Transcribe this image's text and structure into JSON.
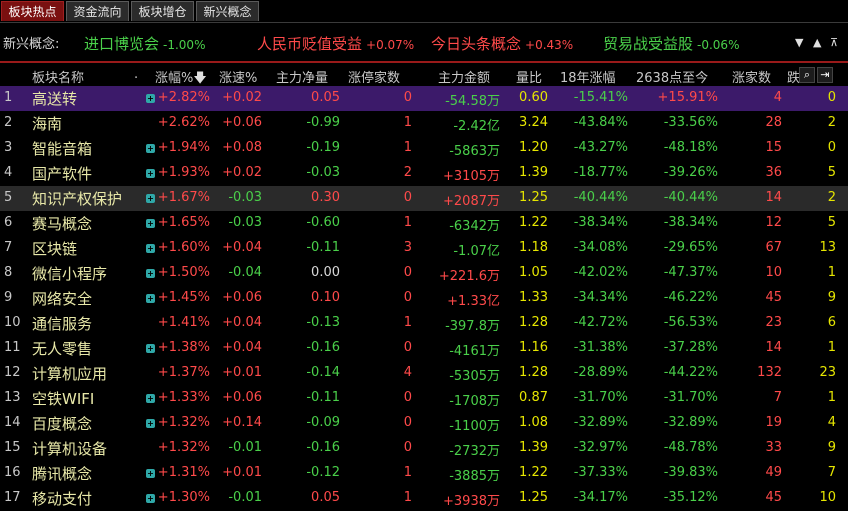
{
  "tabs": [
    {
      "label": "板块热点",
      "active": true
    },
    {
      "label": "资金流向",
      "active": false
    },
    {
      "label": "板块增仓",
      "active": false
    },
    {
      "label": "新兴概念",
      "active": false
    }
  ],
  "ticker": {
    "label": "新兴概念:",
    "items": [
      {
        "name": "进口博览会",
        "value": "-1.00%",
        "color": "#4ad04a"
      },
      {
        "name": "人民币贬值受益",
        "value": "+0.07%",
        "color": "#ff4a4a"
      },
      {
        "name": "今日头条概念",
        "value": "+0.43%",
        "color": "#ff4a4a"
      },
      {
        "name": "贸易战受益股",
        "value": "-0.06%",
        "color": "#4ad04a"
      }
    ]
  },
  "header": {
    "name": "板块名称",
    "dot": ".",
    "change": "涨幅%",
    "speed": "涨速%",
    "main_net": "主力净量",
    "limit_up": "涨停家数",
    "main_amount": "主力金额",
    "vol_ratio": "量比",
    "year18": "18年涨幅",
    "since2638": "2638点至今",
    "rising": "涨家数",
    "fall": "跌"
  },
  "rows": [
    {
      "idx": "1",
      "name": "高送转",
      "plus": true,
      "change": "+2.82%",
      "speed": "+0.02",
      "net": "0.05",
      "limit": "0",
      "amount": "-54.58万",
      "ratio": "0.60",
      "y18": "-15.41%",
      "since": "+15.91%",
      "up": "4",
      "down": "0",
      "highlight": "sel"
    },
    {
      "idx": "2",
      "name": "海南",
      "plus": false,
      "change": "+2.62%",
      "speed": "+0.06",
      "net": "-0.99",
      "limit": "1",
      "amount": "-2.42亿",
      "ratio": "3.24",
      "y18": "-43.84%",
      "since": "-33.56%",
      "up": "28",
      "down": "2",
      "highlight": ""
    },
    {
      "idx": "3",
      "name": "智能音箱",
      "plus": true,
      "change": "+1.94%",
      "speed": "+0.08",
      "net": "-0.19",
      "limit": "1",
      "amount": "-5863万",
      "ratio": "1.20",
      "y18": "-43.27%",
      "since": "-48.18%",
      "up": "15",
      "down": "0",
      "highlight": ""
    },
    {
      "idx": "4",
      "name": "国产软件",
      "plus": true,
      "change": "+1.93%",
      "speed": "+0.02",
      "net": "-0.03",
      "limit": "2",
      "amount": "+3105万",
      "ratio": "1.39",
      "y18": "-18.77%",
      "since": "-39.26%",
      "up": "36",
      "down": "5",
      "highlight": ""
    },
    {
      "idx": "5",
      "name": "知识产权保护",
      "plus": true,
      "change": "+1.67%",
      "speed": "-0.03",
      "net": "0.30",
      "limit": "0",
      "amount": "+2087万",
      "ratio": "1.25",
      "y18": "-40.44%",
      "since": "-40.44%",
      "up": "14",
      "down": "2",
      "highlight": "alt"
    },
    {
      "idx": "6",
      "name": "赛马概念",
      "plus": true,
      "change": "+1.65%",
      "speed": "-0.03",
      "net": "-0.60",
      "limit": "1",
      "amount": "-6342万",
      "ratio": "1.22",
      "y18": "-38.34%",
      "since": "-38.34%",
      "up": "12",
      "down": "5",
      "highlight": ""
    },
    {
      "idx": "7",
      "name": "区块链",
      "plus": true,
      "change": "+1.60%",
      "speed": "+0.04",
      "net": "-0.11",
      "limit": "3",
      "amount": "-1.07亿",
      "ratio": "1.18",
      "y18": "-34.08%",
      "since": "-29.65%",
      "up": "67",
      "down": "13",
      "highlight": ""
    },
    {
      "idx": "8",
      "name": "微信小程序",
      "plus": true,
      "change": "+1.50%",
      "speed": "-0.04",
      "net": "0.00",
      "limit": "0",
      "amount": "+221.6万",
      "ratio": "1.05",
      "y18": "-42.02%",
      "since": "-47.37%",
      "up": "10",
      "down": "1",
      "highlight": ""
    },
    {
      "idx": "9",
      "name": "网络安全",
      "plus": true,
      "change": "+1.45%",
      "speed": "+0.06",
      "net": "0.10",
      "limit": "0",
      "amount": "+1.33亿",
      "ratio": "1.33",
      "y18": "-34.34%",
      "since": "-46.22%",
      "up": "45",
      "down": "9",
      "highlight": ""
    },
    {
      "idx": "10",
      "name": "通信服务",
      "plus": false,
      "change": "+1.41%",
      "speed": "+0.04",
      "net": "-0.13",
      "limit": "1",
      "amount": "-397.8万",
      "ratio": "1.28",
      "y18": "-42.72%",
      "since": "-56.53%",
      "up": "23",
      "down": "6",
      "highlight": ""
    },
    {
      "idx": "11",
      "name": "无人零售",
      "plus": true,
      "change": "+1.38%",
      "speed": "+0.04",
      "net": "-0.16",
      "limit": "0",
      "amount": "-4161万",
      "ratio": "1.16",
      "y18": "-31.38%",
      "since": "-37.28%",
      "up": "14",
      "down": "1",
      "highlight": ""
    },
    {
      "idx": "12",
      "name": "计算机应用",
      "plus": false,
      "change": "+1.37%",
      "speed": "+0.01",
      "net": "-0.14",
      "limit": "4",
      "amount": "-5305万",
      "ratio": "1.28",
      "y18": "-28.89%",
      "since": "-44.22%",
      "up": "132",
      "down": "23",
      "highlight": ""
    },
    {
      "idx": "13",
      "name": "空铁WIFI",
      "plus": true,
      "change": "+1.33%",
      "speed": "+0.06",
      "net": "-0.11",
      "limit": "0",
      "amount": "-1708万",
      "ratio": "0.87",
      "y18": "-31.70%",
      "since": "-31.70%",
      "up": "7",
      "down": "1",
      "highlight": ""
    },
    {
      "idx": "14",
      "name": "百度概念",
      "plus": true,
      "change": "+1.32%",
      "speed": "+0.14",
      "net": "-0.09",
      "limit": "0",
      "amount": "-1100万",
      "ratio": "1.08",
      "y18": "-32.89%",
      "since": "-32.89%",
      "up": "19",
      "down": "4",
      "highlight": ""
    },
    {
      "idx": "15",
      "name": "计算机设备",
      "plus": false,
      "change": "+1.32%",
      "speed": "-0.01",
      "net": "-0.16",
      "limit": "0",
      "amount": "-2732万",
      "ratio": "1.39",
      "y18": "-32.97%",
      "since": "-48.78%",
      "up": "33",
      "down": "9",
      "highlight": ""
    },
    {
      "idx": "16",
      "name": "腾讯概念",
      "plus": true,
      "change": "+1.31%",
      "speed": "+0.01",
      "net": "-0.12",
      "limit": "1",
      "amount": "-3885万",
      "ratio": "1.22",
      "y18": "-37.33%",
      "since": "-39.83%",
      "up": "49",
      "down": "7",
      "highlight": ""
    },
    {
      "idx": "17",
      "name": "移动支付",
      "plus": true,
      "change": "+1.30%",
      "speed": "-0.01",
      "net": "0.05",
      "limit": "1",
      "amount": "+3938万",
      "ratio": "1.25",
      "y18": "-34.17%",
      "since": "-35.12%",
      "up": "45",
      "down": "10",
      "highlight": ""
    }
  ]
}
